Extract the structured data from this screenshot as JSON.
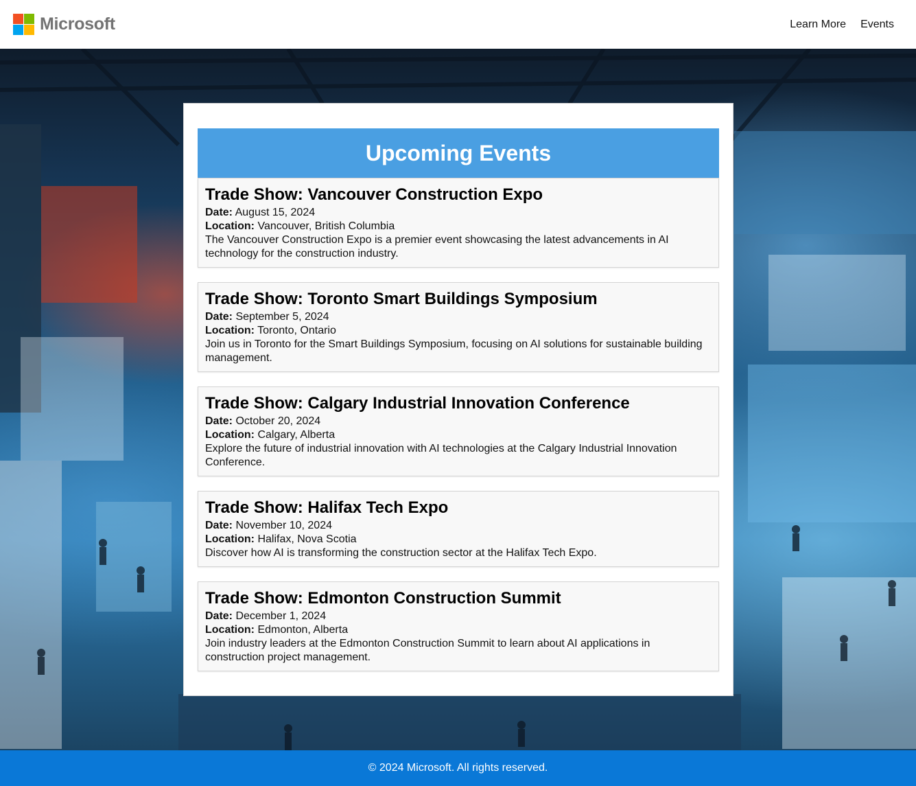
{
  "header": {
    "brand_name": "Microsoft",
    "logo_colors": [
      "#f25022",
      "#7fba00",
      "#00a4ef",
      "#ffb900"
    ],
    "nav": [
      {
        "label": "Learn More"
      },
      {
        "label": "Events"
      }
    ]
  },
  "hero": {
    "background_image": "trade-show-exhibition-hall-photo"
  },
  "events": {
    "heading": "Upcoming Events",
    "date_label": "Date:",
    "location_label": "Location:",
    "items": [
      {
        "title": "Trade Show: Vancouver Construction Expo",
        "date": "August 15, 2024",
        "location": "Vancouver, British Columbia",
        "description": "The Vancouver Construction Expo is a premier event showcasing the latest advancements in AI technology for the construction industry."
      },
      {
        "title": "Trade Show: Toronto Smart Buildings Symposium",
        "date": "September 5, 2024",
        "location": "Toronto, Ontario",
        "description": "Join us in Toronto for the Smart Buildings Symposium, focusing on AI solutions for sustainable building management."
      },
      {
        "title": "Trade Show: Calgary Industrial Innovation Conference",
        "date": "October 20, 2024",
        "location": "Calgary, Alberta",
        "description": "Explore the future of industrial innovation with AI technologies at the Calgary Industrial Innovation Conference."
      },
      {
        "title": "Trade Show: Halifax Tech Expo",
        "date": "November 10, 2024",
        "location": "Halifax, Nova Scotia",
        "description": "Discover how AI is transforming the construction sector at the Halifax Tech Expo."
      },
      {
        "title": "Trade Show: Edmonton Construction Summit",
        "date": "December 1, 2024",
        "location": "Edmonton, Alberta",
        "description": "Join industry leaders at the Edmonton Construction Summit to learn about AI applications in construction project management."
      }
    ]
  },
  "footer": {
    "text": "© 2024 Microsoft. All rights reserved."
  },
  "colors": {
    "heading_bar": "#4a9fe2",
    "footer_bar": "#0a78d7"
  }
}
